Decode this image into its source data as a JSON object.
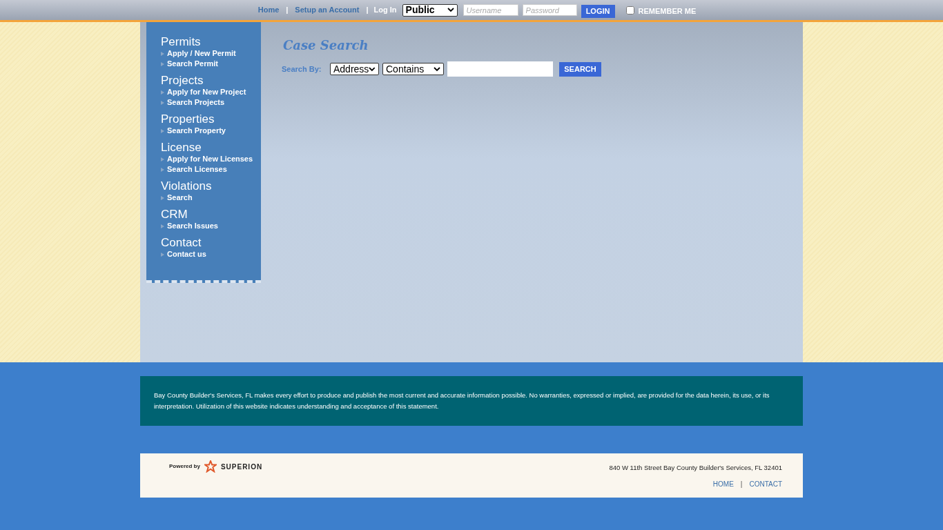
{
  "top_bar": {
    "links": [
      {
        "kind": "link",
        "text": "Home"
      },
      {
        "kind": "separator",
        "text": "|"
      },
      {
        "kind": "link",
        "text": "Setup an Account"
      },
      {
        "kind": "separator",
        "text": "|"
      }
    ],
    "login_label": "Log In",
    "role_select": "Public",
    "username": {
      "placeholder": "Username"
    },
    "password": {
      "placeholder": "Password"
    },
    "login_button": "LOGIN",
    "remember_me": {
      "label": "REMEMBER ME",
      "checked": false
    }
  },
  "sidebar": {
    "sections": [
      {
        "title": "Permits",
        "items": [
          "Apply / New Permit",
          "Search Permit"
        ]
      },
      {
        "title": "Projects",
        "items": [
          "Apply for New Project",
          "Search Projects"
        ]
      },
      {
        "title": "Properties",
        "items": [
          "Search Property"
        ]
      },
      {
        "title": "License",
        "items": [
          "Apply for New Licenses",
          "Search Licenses"
        ]
      },
      {
        "title": "Violations",
        "items": [
          "Search"
        ]
      },
      {
        "title": "CRM",
        "items": [
          "Search Issues"
        ]
      },
      {
        "title": "Contact",
        "items": [
          "Contact us"
        ]
      }
    ]
  },
  "case_search": {
    "title": "Case Search",
    "search_by_label": "Search By:",
    "field_select": "Address",
    "match_select": "Contains",
    "search_button": "SEARCH"
  },
  "disclaimer": "Bay County Builder's Services, FL makes every effort to produce and publish the most current and accurate information possible. No warranties, expressed or implied, are provided for the data herein, its use, or its interpretation. Utilization of this website indicates understanding and acceptance of this statement.",
  "footer": {
    "powered_by": "Powered by",
    "brand": "SUPERION",
    "address": "840 W 11th Street Bay County Builder's Services, FL 32401",
    "links": [
      {
        "kind": "link",
        "text": "HOME"
      },
      {
        "kind": "separator",
        "text": "|"
      },
      {
        "kind": "link",
        "text": "CONTACT"
      }
    ]
  }
}
